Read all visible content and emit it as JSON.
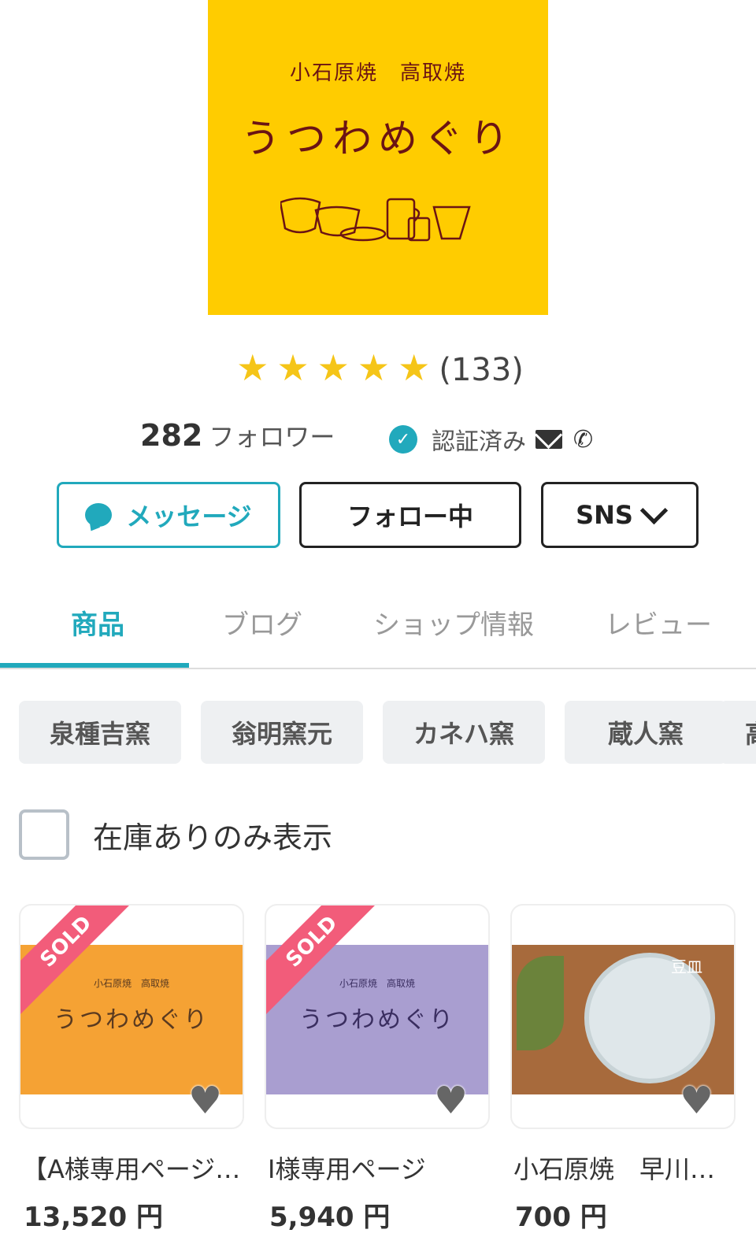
{
  "shop": {
    "logo_sub": "小石原焼　高取焼",
    "logo_name": "うつわめぐり",
    "rating_count": "(133)",
    "rating_stars": 5,
    "followers_count": "282",
    "followers_label": "フォロワー",
    "verified_label": "認証済み"
  },
  "buttons": {
    "message": "メッセージ",
    "following": "フォロー中",
    "sns": "SNS"
  },
  "tabs": [
    {
      "label": "商品",
      "active": true
    },
    {
      "label": "ブログ",
      "active": false
    },
    {
      "label": "ショップ情報",
      "active": false
    },
    {
      "label": "レビュー",
      "active": false
    }
  ],
  "categories": [
    "泉種吉窯",
    "翁明窯元",
    "カネハ窯",
    "蔵人窯",
    "高"
  ],
  "filter": {
    "in_stock_label": "在庫ありのみ表示",
    "checked": false
  },
  "products": [
    {
      "title": "【A様専用ページ…",
      "price": "13,520 円",
      "sold": "SOLD",
      "img_sub": "小石原焼　高取焼",
      "img_name": "うつわめぐり"
    },
    {
      "title": "I様専用ページ",
      "price": "5,940 円",
      "sold": "SOLD",
      "img_sub": "小石原焼　高取焼",
      "img_name": "うつわめぐり"
    },
    {
      "title": "小石原焼　早川…",
      "price": "700 円",
      "img_label": "豆皿"
    }
  ],
  "colors": {
    "accent": "#21a9bc",
    "logo_bg": "#FFCC00",
    "star": "#F5C518",
    "sold": "#F25C7A"
  }
}
